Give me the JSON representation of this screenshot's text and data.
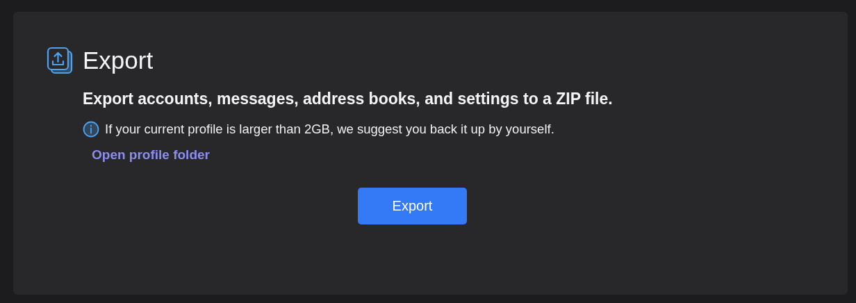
{
  "title": "Export",
  "headline": "Export accounts, messages, address books, and settings to a ZIP file.",
  "info": "If your current profile is larger than 2GB, we suggest you back it up by yourself.",
  "link": "Open profile folder",
  "button": "Export"
}
